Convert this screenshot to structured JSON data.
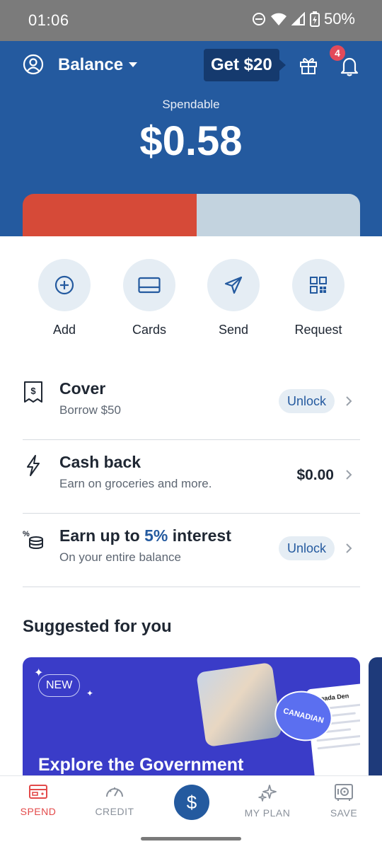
{
  "status_bar": {
    "time": "01:06",
    "battery": "50%"
  },
  "header": {
    "account_selector": "Balance",
    "promo_label": "Get $20",
    "notification_count": "4",
    "spendable_label": "Spendable",
    "spendable_amount": "$0.58",
    "balance_bar": {
      "used_fraction": 0.515,
      "used_color": "#d64a38",
      "rest_color": "#c3d3df"
    },
    "background_color": "#245a9f"
  },
  "actions": [
    {
      "label": "Add",
      "icon": "plus-circle-icon"
    },
    {
      "label": "Cards",
      "icon": "card-icon"
    },
    {
      "label": "Send",
      "icon": "paper-plane-icon"
    },
    {
      "label": "Request",
      "icon": "qr-grid-icon"
    }
  ],
  "rows": [
    {
      "title": "Cover",
      "subtitle": "Borrow $50",
      "action_label": "Unlock",
      "icon": "receipt-dollar-icon"
    },
    {
      "title": "Cash back",
      "subtitle": "Earn on groceries and more.",
      "value": "$0.00",
      "icon": "lightning-icon"
    },
    {
      "title_prefix": "Earn up to ",
      "title_highlight": "5%",
      "title_suffix": " interest",
      "subtitle": "On your entire balance",
      "action_label": "Unlock",
      "icon": "coins-percent-icon"
    }
  ],
  "suggested": {
    "title": "Suggested for you",
    "card": {
      "tag": "NEW",
      "stamp": "CANADIAN",
      "doc_title": "Canada Den",
      "headline": "Explore the Government"
    }
  },
  "bottom_nav": [
    {
      "label": "SPEND",
      "icon": "wallet-icon",
      "active": true
    },
    {
      "label": "CREDIT",
      "icon": "speedometer-icon",
      "active": false
    },
    {
      "label": "$",
      "icon": "dollar-fab",
      "active": false
    },
    {
      "label": "MY PLAN",
      "icon": "sparkles-icon",
      "active": false
    },
    {
      "label": "SAVE",
      "icon": "safe-icon",
      "active": false
    }
  ],
  "colors": {
    "accent": "#245a9f",
    "active_nav": "#e34a4a",
    "pill_bg": "#e5edf4"
  }
}
